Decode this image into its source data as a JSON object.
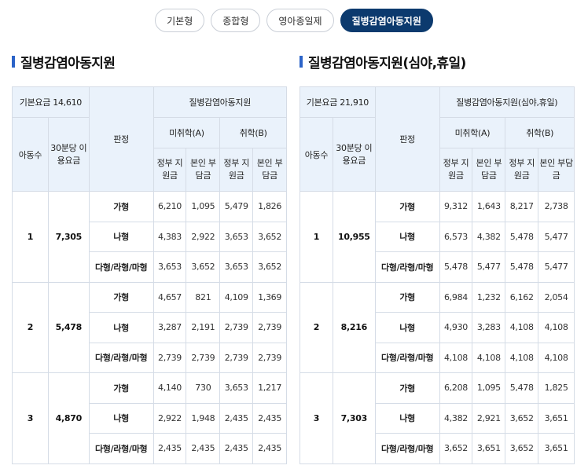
{
  "tabs": [
    {
      "label": "기본형",
      "active": false
    },
    {
      "label": "종합형",
      "active": false
    },
    {
      "label": "영아종일제",
      "active": false
    },
    {
      "label": "질병감염아동지원",
      "active": true
    }
  ],
  "panels": [
    {
      "title": "질병감염아동지원",
      "base_fee_label": "기본요금 14,610",
      "main_header": "질병감염아동지원",
      "col_children": "아동수",
      "col_fee": "30분당 이용요금",
      "col_grade": "판정",
      "col_preschool": "미취학(A)",
      "col_school": "취학(B)",
      "col_gov": "정부 지원금",
      "col_self": "본인 부담금",
      "groups": [
        {
          "children": "1",
          "fee": "7,305",
          "rows": [
            {
              "type": "가형",
              "a_gov": "6,210",
              "a_self": "1,095",
              "b_gov": "5,479",
              "b_self": "1,826"
            },
            {
              "type": "나형",
              "a_gov": "4,383",
              "a_self": "2,922",
              "b_gov": "3,653",
              "b_self": "3,652"
            },
            {
              "type": "다형/라형/마형",
              "a_gov": "3,653",
              "a_self": "3,652",
              "b_gov": "3,653",
              "b_self": "3,652"
            }
          ]
        },
        {
          "children": "2",
          "fee": "5,478",
          "rows": [
            {
              "type": "가형",
              "a_gov": "4,657",
              "a_self": "821",
              "b_gov": "4,109",
              "b_self": "1,369"
            },
            {
              "type": "나형",
              "a_gov": "3,287",
              "a_self": "2,191",
              "b_gov": "2,739",
              "b_self": "2,739"
            },
            {
              "type": "다형/라형/마형",
              "a_gov": "2,739",
              "a_self": "2,739",
              "b_gov": "2,739",
              "b_self": "2,739"
            }
          ]
        },
        {
          "children": "3",
          "fee": "4,870",
          "rows": [
            {
              "type": "가형",
              "a_gov": "4,140",
              "a_self": "730",
              "b_gov": "3,653",
              "b_self": "1,217"
            },
            {
              "type": "나형",
              "a_gov": "2,922",
              "a_self": "1,948",
              "b_gov": "2,435",
              "b_self": "2,435"
            },
            {
              "type": "다형/라형/마형",
              "a_gov": "2,435",
              "a_self": "2,435",
              "b_gov": "2,435",
              "b_self": "2,435"
            }
          ]
        }
      ]
    },
    {
      "title": "질병감염아동지원(심야,휴일)",
      "base_fee_label": "기본요금 21,910",
      "main_header": "질병감염아동지원(심야,휴일)",
      "col_children": "아동수",
      "col_fee": "30분당 이용요금",
      "col_grade": "판정",
      "col_preschool": "미취학(A)",
      "col_school": "취학(B)",
      "col_gov": "정부 지원금",
      "col_self": "본인 부담금",
      "groups": [
        {
          "children": "1",
          "fee": "10,955",
          "rows": [
            {
              "type": "가형",
              "a_gov": "9,312",
              "a_self": "1,643",
              "b_gov": "8,217",
              "b_self": "2,738"
            },
            {
              "type": "나형",
              "a_gov": "6,573",
              "a_self": "4,382",
              "b_gov": "5,478",
              "b_self": "5,477"
            },
            {
              "type": "다형/라형/마형",
              "a_gov": "5,478",
              "a_self": "5,477",
              "b_gov": "5,478",
              "b_self": "5,477"
            }
          ]
        },
        {
          "children": "2",
          "fee": "8,216",
          "rows": [
            {
              "type": "가형",
              "a_gov": "6,984",
              "a_self": "1,232",
              "b_gov": "6,162",
              "b_self": "2,054"
            },
            {
              "type": "나형",
              "a_gov": "4,930",
              "a_self": "3,283",
              "b_gov": "4,108",
              "b_self": "4,108"
            },
            {
              "type": "다형/라형/마형",
              "a_gov": "4,108",
              "a_self": "4,108",
              "b_gov": "4,108",
              "b_self": "4,108"
            }
          ]
        },
        {
          "children": "3",
          "fee": "7,303",
          "rows": [
            {
              "type": "가형",
              "a_gov": "6,208",
              "a_self": "1,095",
              "b_gov": "5,478",
              "b_self": "1,825"
            },
            {
              "type": "나형",
              "a_gov": "4,382",
              "a_self": "2,921",
              "b_gov": "3,652",
              "b_self": "3,651"
            },
            {
              "type": "다형/라형/마형",
              "a_gov": "3,652",
              "a_self": "3,651",
              "b_gov": "3,652",
              "b_self": "3,651"
            }
          ]
        }
      ]
    }
  ]
}
